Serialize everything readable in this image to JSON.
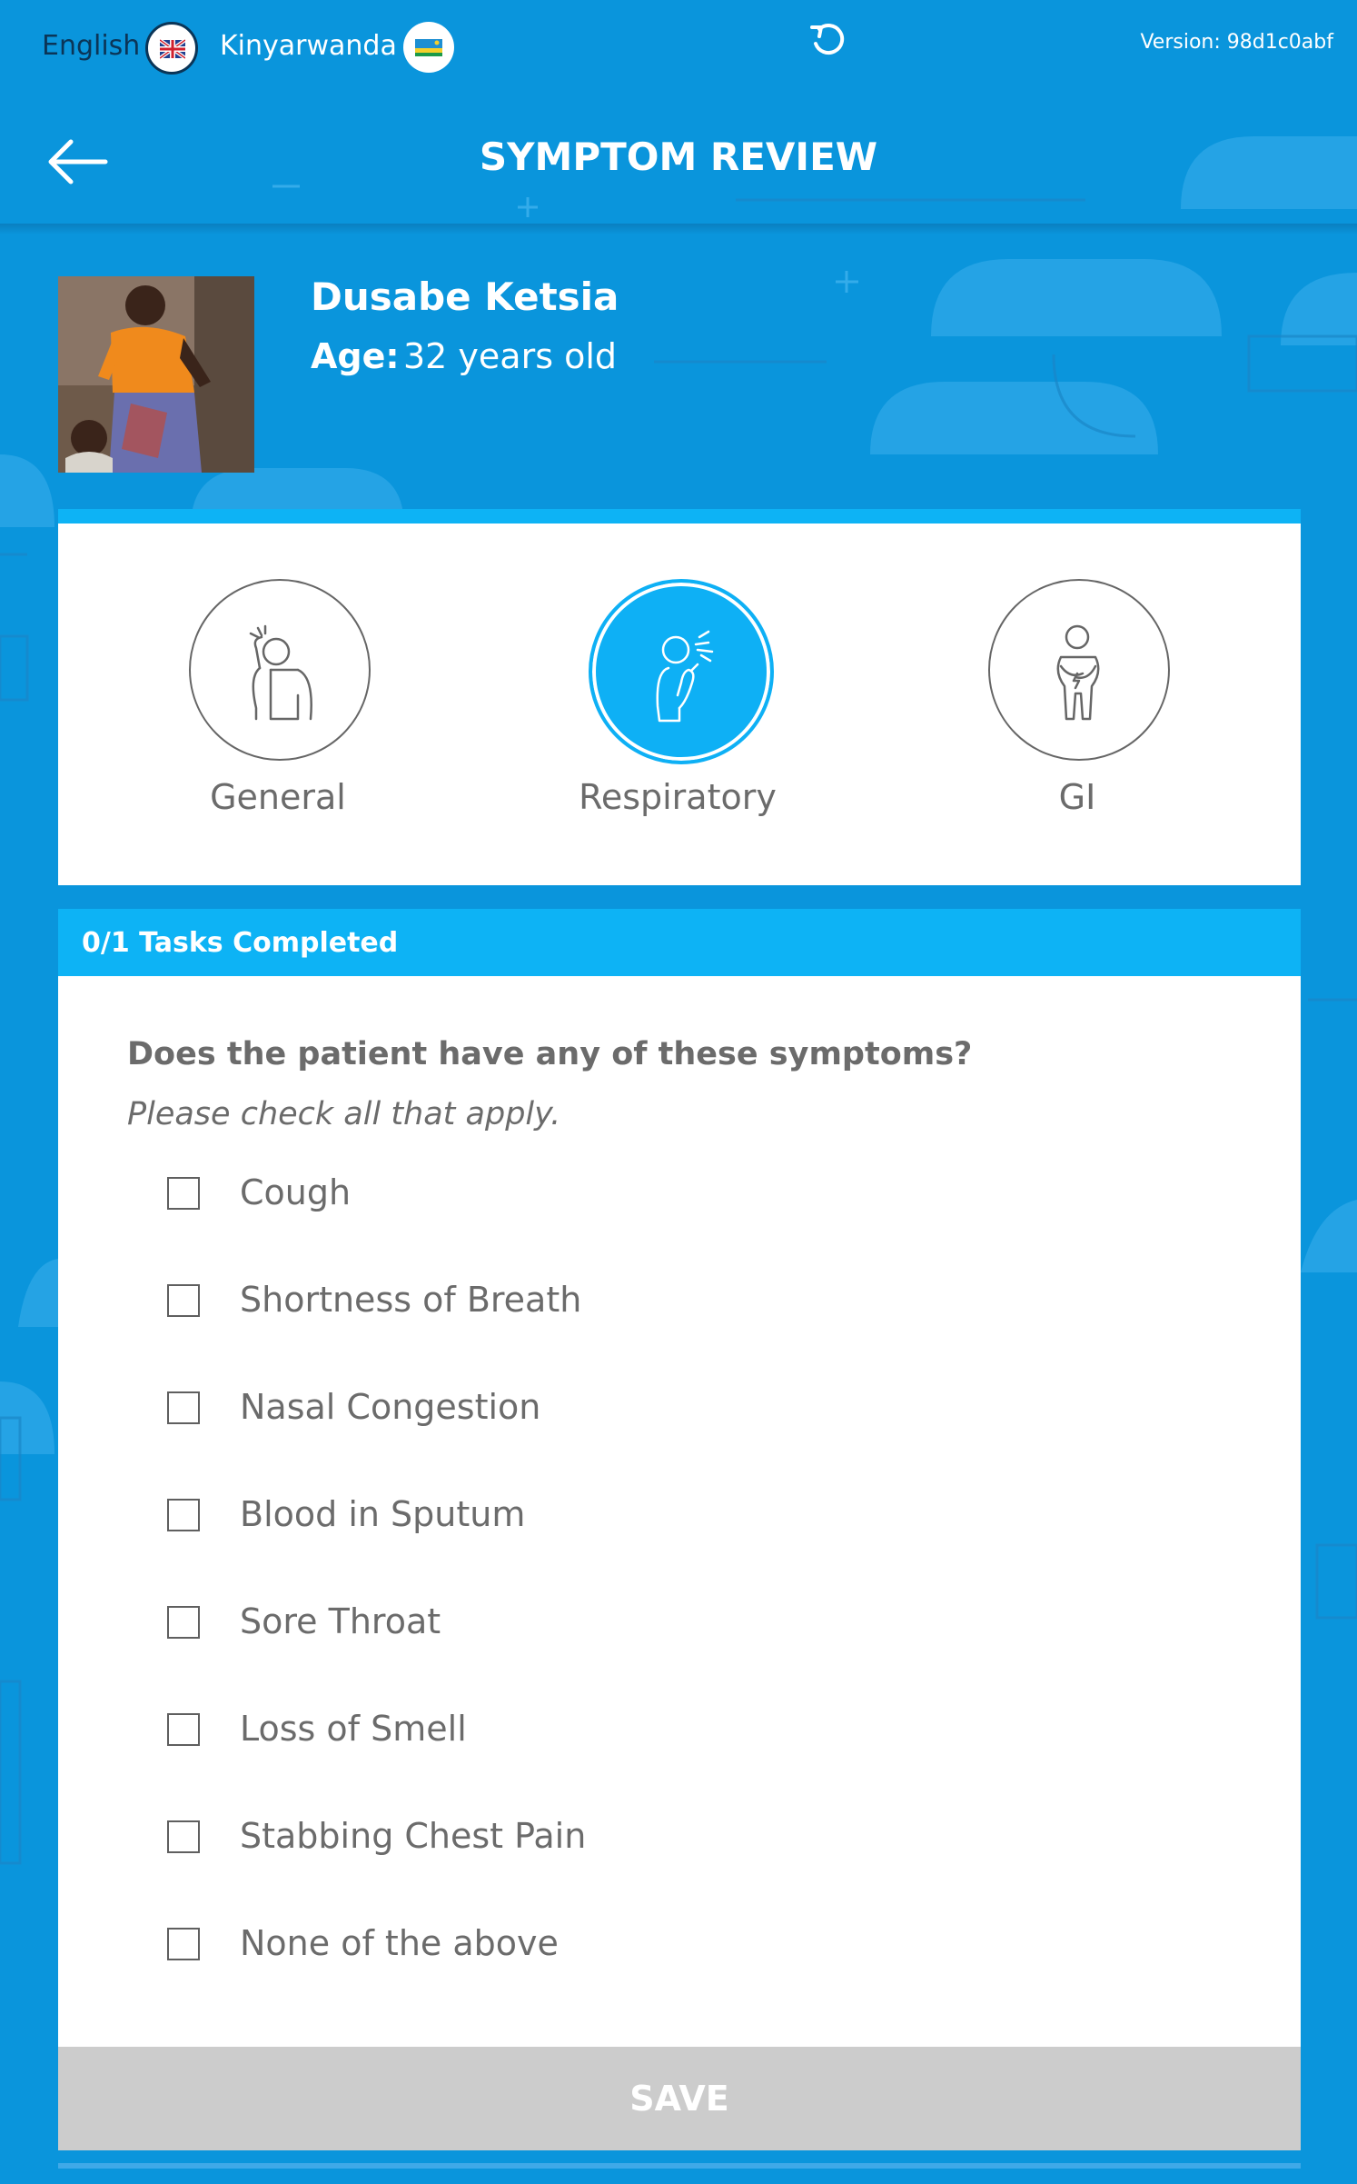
{
  "topbar": {
    "lang_english": "English",
    "lang_kinyarwanda": "Kinyarwanda",
    "version": "Version: 98d1c0abf"
  },
  "header": {
    "title": "SYMPTOM REVIEW"
  },
  "patient": {
    "name": "Dusabe Ketsia",
    "age_label": "Age:",
    "age_value": "32 years old"
  },
  "categories": [
    {
      "label": "General",
      "active": false,
      "icon": "sick-person-icon"
    },
    {
      "label": "Respiratory",
      "active": true,
      "icon": "coughing-person-icon"
    },
    {
      "label": "GI",
      "active": false,
      "icon": "stomach-ache-icon"
    }
  ],
  "tasks": {
    "status": "0/1 Tasks Completed"
  },
  "form": {
    "question": "Does the patient have any of these symptoms?",
    "instruction": "Please check all that apply.",
    "options": [
      {
        "label": "Cough",
        "checked": false
      },
      {
        "label": "Shortness of Breath",
        "checked": false
      },
      {
        "label": "Nasal Congestion",
        "checked": false
      },
      {
        "label": "Blood in Sputum",
        "checked": false
      },
      {
        "label": "Sore Throat",
        "checked": false
      },
      {
        "label": "Loss of Smell",
        "checked": false
      },
      {
        "label": "Stabbing Chest Pain",
        "checked": false
      },
      {
        "label": "None of the above",
        "checked": false
      }
    ],
    "save_label": "SAVE"
  },
  "colors": {
    "background": "#0a95dc",
    "accent": "#0db3f5",
    "text_gray": "#6b6b6b",
    "save_disabled": "#cccccc"
  }
}
